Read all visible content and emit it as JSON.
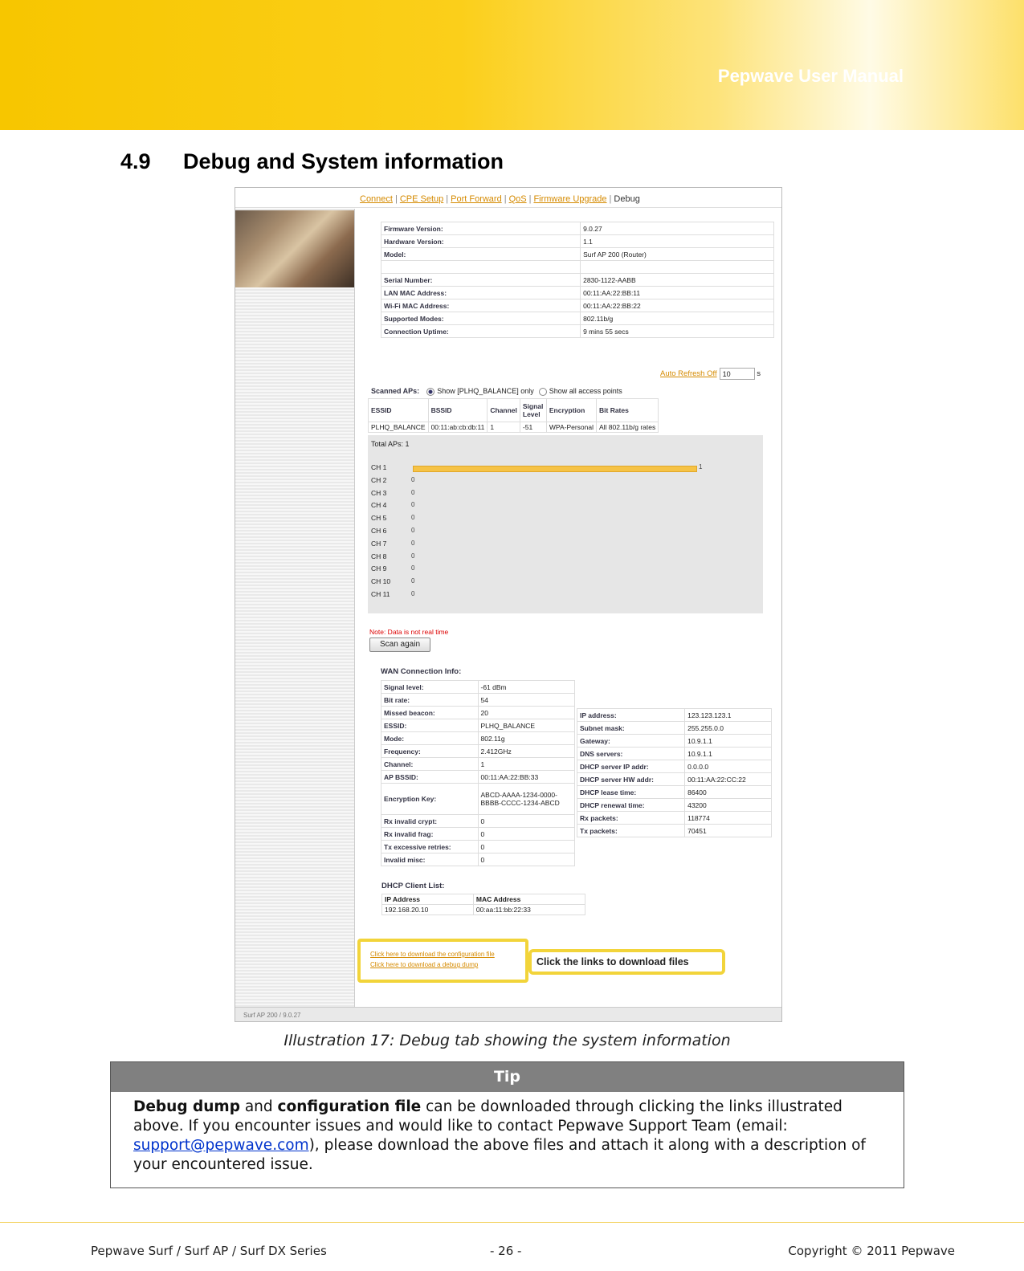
{
  "header": {
    "title": "Pepwave User Manual"
  },
  "section": {
    "number": "4.9",
    "title": "Debug and System information"
  },
  "screenshot": {
    "nav": [
      "Connect",
      "CPE Setup",
      "Port Forward",
      "QoS",
      "Firmware Upgrade"
    ],
    "nav_current": "Debug",
    "system_info": [
      {
        "k": "Firmware Version:",
        "v": "9.0.27"
      },
      {
        "k": "Hardware Version:",
        "v": "1.1"
      },
      {
        "k": "Model:",
        "v": "Surf AP 200 (Router)"
      },
      {
        "k": "",
        "v": ""
      },
      {
        "k": "Serial Number:",
        "v": "2830-1122-AABB"
      },
      {
        "k": "LAN MAC Address:",
        "v": "00:11:AA:22:BB:11"
      },
      {
        "k": "Wi-Fi MAC Address:",
        "v": "00:11:AA:22:BB:22"
      },
      {
        "k": "Supported Modes:",
        "v": "802.11b/g"
      },
      {
        "k": "Connection Uptime:",
        "v": "9 mins 55 secs"
      }
    ],
    "auto_refresh": {
      "link": "Auto Refresh Off",
      "value": "10",
      "unit": "s"
    },
    "scan": {
      "label": "Scanned APs:",
      "opt1": "Show [PLHQ_BALANCE] only",
      "opt2": "Show all access points"
    },
    "ap_table": {
      "headers": [
        "ESSID",
        "BSSID",
        "Channel",
        "Signal Level",
        "Encryption",
        "Bit Rates"
      ],
      "row": [
        "PLHQ_BALANCE",
        "00:11:ab:cb:db:11",
        "1",
        "-51",
        "WPA-Personal",
        "All 802.11b/g rates"
      ]
    },
    "channels": {
      "total": "Total APs:  1",
      "rows": [
        {
          "ch": "CH 1",
          "count": 1
        },
        {
          "ch": "CH 2",
          "count": 0
        },
        {
          "ch": "CH 3",
          "count": 0
        },
        {
          "ch": "CH 4",
          "count": 0
        },
        {
          "ch": "CH 5",
          "count": 0
        },
        {
          "ch": "CH 6",
          "count": 0
        },
        {
          "ch": "CH 7",
          "count": 0
        },
        {
          "ch": "CH 8",
          "count": 0
        },
        {
          "ch": "CH 9",
          "count": 0
        },
        {
          "ch": "CH 10",
          "count": 0
        },
        {
          "ch": "CH 11",
          "count": 0
        }
      ]
    },
    "note": "Note: Data is not real time",
    "scan_button": "Scan again",
    "wan_title": "WAN Connection Info:",
    "wan_left": [
      {
        "k": "Signal level:",
        "v": "-61 dBm"
      },
      {
        "k": "Bit rate:",
        "v": "54"
      },
      {
        "k": "Missed beacon:",
        "v": "20"
      },
      {
        "k": "ESSID:",
        "v": "PLHQ_BALANCE"
      },
      {
        "k": "Mode:",
        "v": "802.11g"
      },
      {
        "k": "Frequency:",
        "v": "2.412GHz"
      },
      {
        "k": "Channel:",
        "v": "1"
      },
      {
        "k": "AP BSSID:",
        "v": "00:11:AA:22:BB:33"
      },
      {
        "k": "Encryption Key:",
        "v": "ABCD-AAAA-1234-0000-BBBB-CCCC-1234-ABCD"
      },
      {
        "k": "Rx invalid crypt:",
        "v": "0"
      },
      {
        "k": "Rx invalid frag:",
        "v": "0"
      },
      {
        "k": "Tx excessive retries:",
        "v": "0"
      },
      {
        "k": "Invalid misc:",
        "v": "0"
      }
    ],
    "wan_right": [
      {
        "k": "IP address:",
        "v": "123.123.123.1"
      },
      {
        "k": "Subnet mask:",
        "v": "255.255.0.0"
      },
      {
        "k": "Gateway:",
        "v": "10.9.1.1"
      },
      {
        "k": "DNS servers:",
        "v": "10.9.1.1"
      },
      {
        "k": "DHCP server IP addr:",
        "v": "0.0.0.0"
      },
      {
        "k": "DHCP server HW addr:",
        "v": "00:11:AA:22:CC:22"
      },
      {
        "k": "DHCP lease time:",
        "v": "86400"
      },
      {
        "k": "DHCP renewal time:",
        "v": "43200"
      },
      {
        "k": "Rx packets:",
        "v": "118774"
      },
      {
        "k": "Tx packets:",
        "v": "70451"
      }
    ],
    "dhcp": {
      "title": "DHCP Client List:",
      "headers": [
        "IP Address",
        "MAC Address"
      ],
      "row": [
        "192.168.20.10",
        "00:aa:11:bb:22:33"
      ]
    },
    "links": [
      "Click here to download the configuration file",
      "Click here to download a debug dump"
    ],
    "callout": "Click the links to download files",
    "footer": "Surf AP 200 / 9.0.27"
  },
  "caption": "Illustration 17: Debug tab showing the system information",
  "tip": {
    "title": "Tip",
    "bold1": "Debug dump",
    "t1": " and ",
    "bold2": "configuration file",
    "t2": " can be downloaded through clicking the links illustrated above. If you encounter issues and would like to contact Pepwave Support Team (email: ",
    "email": "support@pepwave.com",
    "t3": "), please download the above files and attach it along with a description of your encountered issue."
  },
  "footer": {
    "left": "Pepwave Surf / Surf AP / Surf DX Series",
    "page": "- 26 -",
    "right": "Copyright © 2011 Pepwave"
  }
}
